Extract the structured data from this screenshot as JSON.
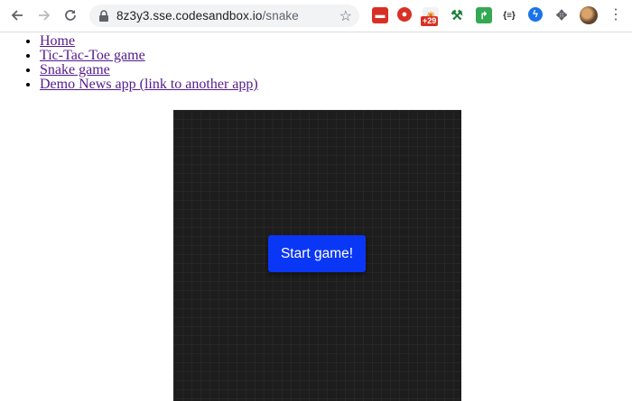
{
  "browser": {
    "url_host": "8z3y3.sse.codesandbox.io",
    "url_path": "/snake",
    "extension_badge": "+29"
  },
  "nav": {
    "items": [
      {
        "label": "Home"
      },
      {
        "label": "Tic-Tac-Toe game"
      },
      {
        "label": "Snake game"
      },
      {
        "label": "Demo News app (link to another app)"
      }
    ]
  },
  "game": {
    "start_label": "Start game!",
    "board_color": "#1d1d1d",
    "button_color": "#0a37f5"
  }
}
